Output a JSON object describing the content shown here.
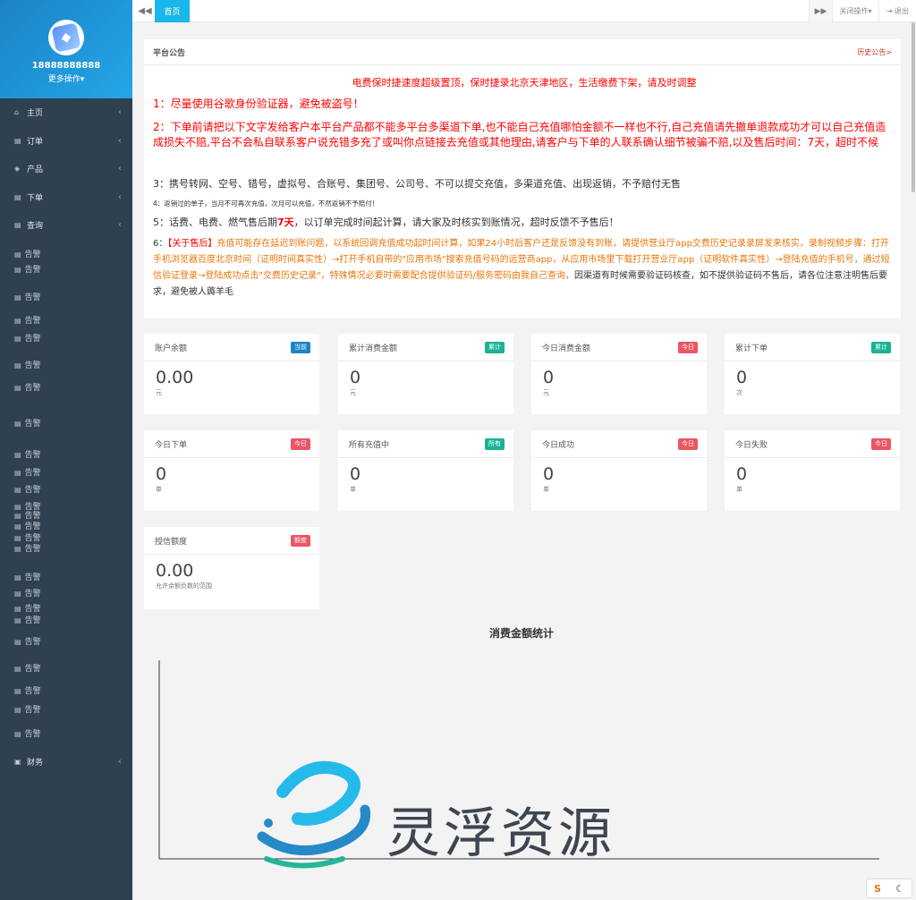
{
  "user": {
    "phone": "18888888888",
    "more": "更多操作"
  },
  "nav": {
    "main": [
      {
        "label": "主页",
        "icon": "home-icon"
      },
      {
        "label": "订单",
        "icon": "file-icon"
      },
      {
        "label": "产品",
        "icon": "cube-icon"
      },
      {
        "label": "下单",
        "icon": "file-icon"
      },
      {
        "label": "查询",
        "icon": "file-icon"
      }
    ],
    "sub_label": "告警",
    "finance": "财务"
  },
  "topbar": {
    "home_tab": "首页",
    "close_ops": "关闭操作",
    "logout": "退出"
  },
  "notice": {
    "title": "平台公告",
    "history": "历史公告>",
    "line0": "电费保时捷速度超级置顶，保时捷录北京天津地区，生活缴费下架，请及时调整",
    "line1": "1：尽量使用谷歌身份验证器，避免被盗号！",
    "line2": "2：下单前请把以下文字发给客户本平台产品都不能多平台多渠道下单,也不能自己充值哪怕金额不一样也不行,自己充值请先撤单退款成功才可以自己充值造成损失不赔,平台不会私自联系客户说充错多充了或叫你点链接去充值或其他理由,请客户与下单的人联系确认细节被骗不赔,以及售后时间：7天，超时不候",
    "line3": "3：携号转网、空号、错号，虚拟号、合账号、集团号、公司号、不可以提交充值，多渠道充值、出现返销，不予赔付无售",
    "line4": "4：返销过的单子，当月不可再次充值，次月可以充值，不然返销不予赔付！",
    "line5a": "5：话费、电费、燃气售后期",
    "line5b": "7天",
    "line5c": "，以订单完成时间起计算，请大家及时核实到账情况，超时反馈不予售后！",
    "line6a": "6：",
    "line6b": "【关于售后】",
    "line6c": "充值可能存在延迟到账问题，以系统回调充值成功起时间计算，如果24小时后客户还是反馈没有到账，请提供营业厅app交费历史记录录屏发来核实，录制视频步骤：打开手机浏览器百度北京时间（证明时间真实性）→打开手机自带的\"应用市场\"搜索充值号码的运营商app，从应用市场里下载打开营业厅app（证明软件真实性）→登陆充值的手机号，通过短信验证登录→登陆成功点击\"交费历史记录\"，特殊情况必要时需要配合提供验证码/服务密码由我自己查询，",
    "line6d": "因渠道有时候需要验证码核查，如不提供验证码不售后，请各位注意注明售后要求，避免被人薅羊毛"
  },
  "cards": [
    {
      "title": "账户余额",
      "badge": "当前",
      "badge_color": "#1c84c6",
      "value": "0.00",
      "unit": "元"
    },
    {
      "title": "累计消费金额",
      "badge": "累计",
      "badge_color": "#1ab394",
      "value": "0",
      "unit": "元"
    },
    {
      "title": "今日消费金额",
      "badge": "今日",
      "badge_color": "#ed5565",
      "value": "0",
      "unit": "元"
    },
    {
      "title": "累计下单",
      "badge": "累计",
      "badge_color": "#1ab394",
      "value": "0",
      "unit": "次"
    },
    {
      "title": "今日下单",
      "badge": "今日",
      "badge_color": "#ed5565",
      "value": "0",
      "unit": "单"
    },
    {
      "title": "所有充值中",
      "badge": "所有",
      "badge_color": "#1ab394",
      "value": "0",
      "unit": "单"
    },
    {
      "title": "今日成功",
      "badge": "今日",
      "badge_color": "#ed5565",
      "value": "0",
      "unit": "单"
    },
    {
      "title": "今日失败",
      "badge": "今日",
      "badge_color": "#ed5565",
      "value": "0",
      "unit": "单"
    },
    {
      "title": "授信额度",
      "badge": "额度",
      "badge_color": "#ed5565",
      "value": "0.00",
      "unit": "允许余额负数的范围"
    }
  ],
  "chart": {
    "title": "消费金额统计"
  },
  "watermark": "灵浮资源"
}
